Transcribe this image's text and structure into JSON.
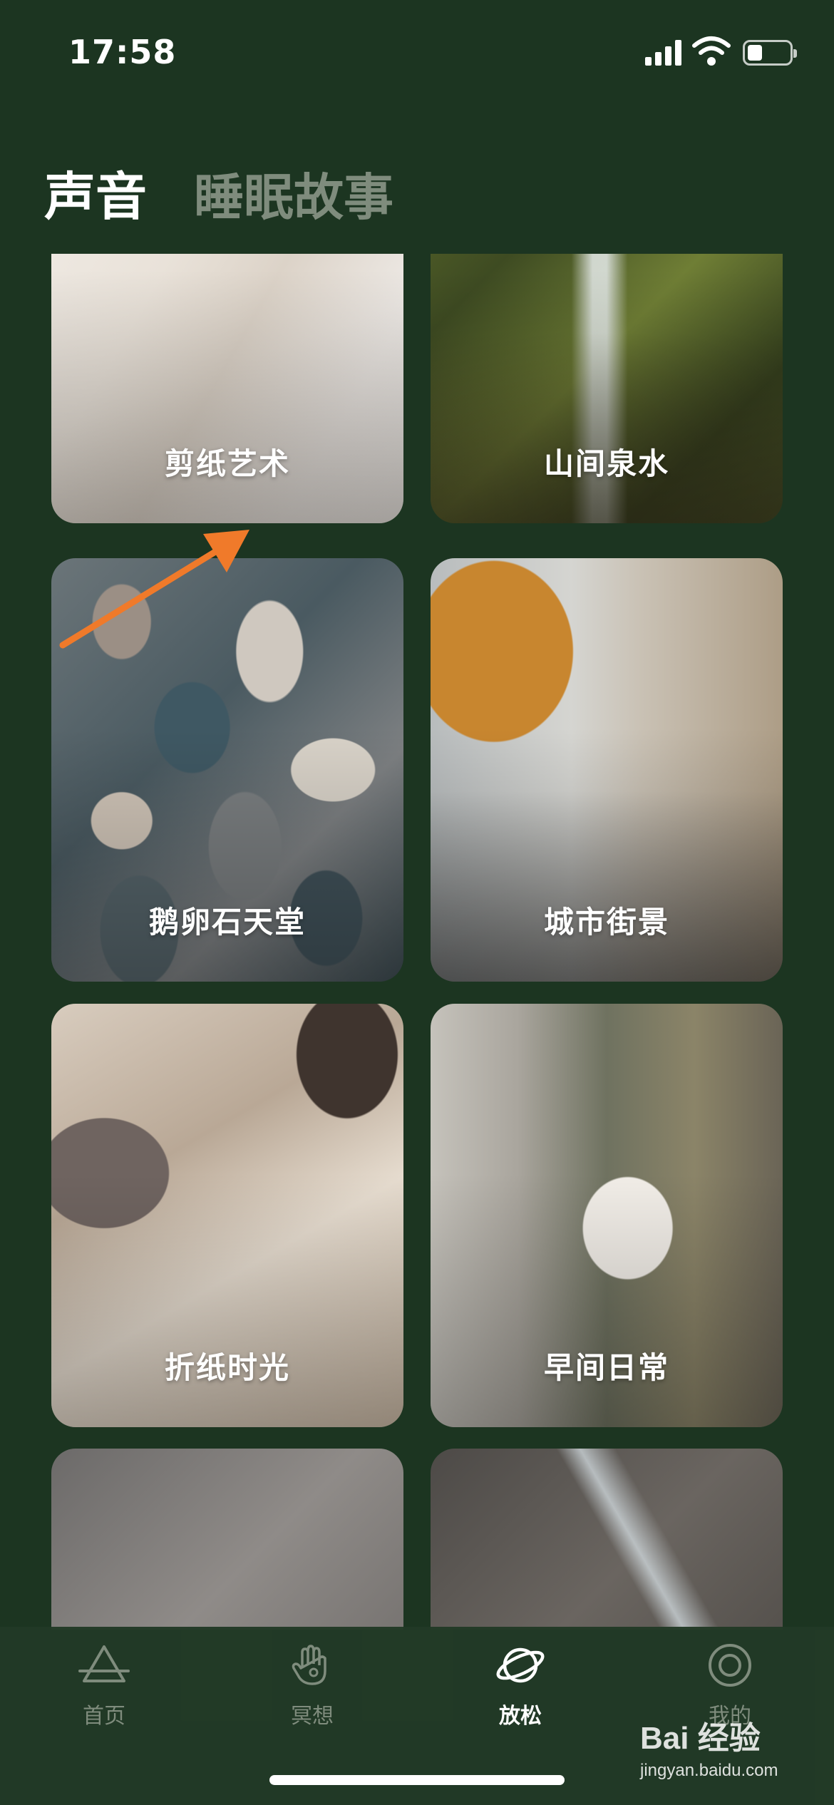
{
  "status_bar": {
    "time": "17:58",
    "signal_icon": "signal-bars-icon",
    "wifi_icon": "wifi-icon",
    "battery_icon": "battery-icon"
  },
  "tabs": {
    "active": "声音",
    "inactive": "睡眠故事"
  },
  "cards": [
    {
      "label": "剪纸艺术"
    },
    {
      "label": "山间泉水"
    },
    {
      "label": "鹅卵石天堂"
    },
    {
      "label": "城市街景"
    },
    {
      "label": "折纸时光"
    },
    {
      "label": "早间日常"
    },
    {
      "label": ""
    },
    {
      "label": ""
    }
  ],
  "nav": {
    "items": [
      {
        "label": "首页",
        "icon": "triangle-home-icon",
        "active": false
      },
      {
        "label": "冥想",
        "icon": "hand-meditation-icon",
        "active": false
      },
      {
        "label": "放松",
        "icon": "planet-relax-icon",
        "active": true
      },
      {
        "label": "我的",
        "icon": "profile-circle-icon",
        "active": false
      }
    ]
  },
  "watermark": {
    "top": "Bai 经验",
    "bottom": "jingyan.baidu.com"
  },
  "colors": {
    "background": "#1c3521",
    "arrow": "#f07a2a",
    "inactive_text": "#7f8c7d"
  }
}
